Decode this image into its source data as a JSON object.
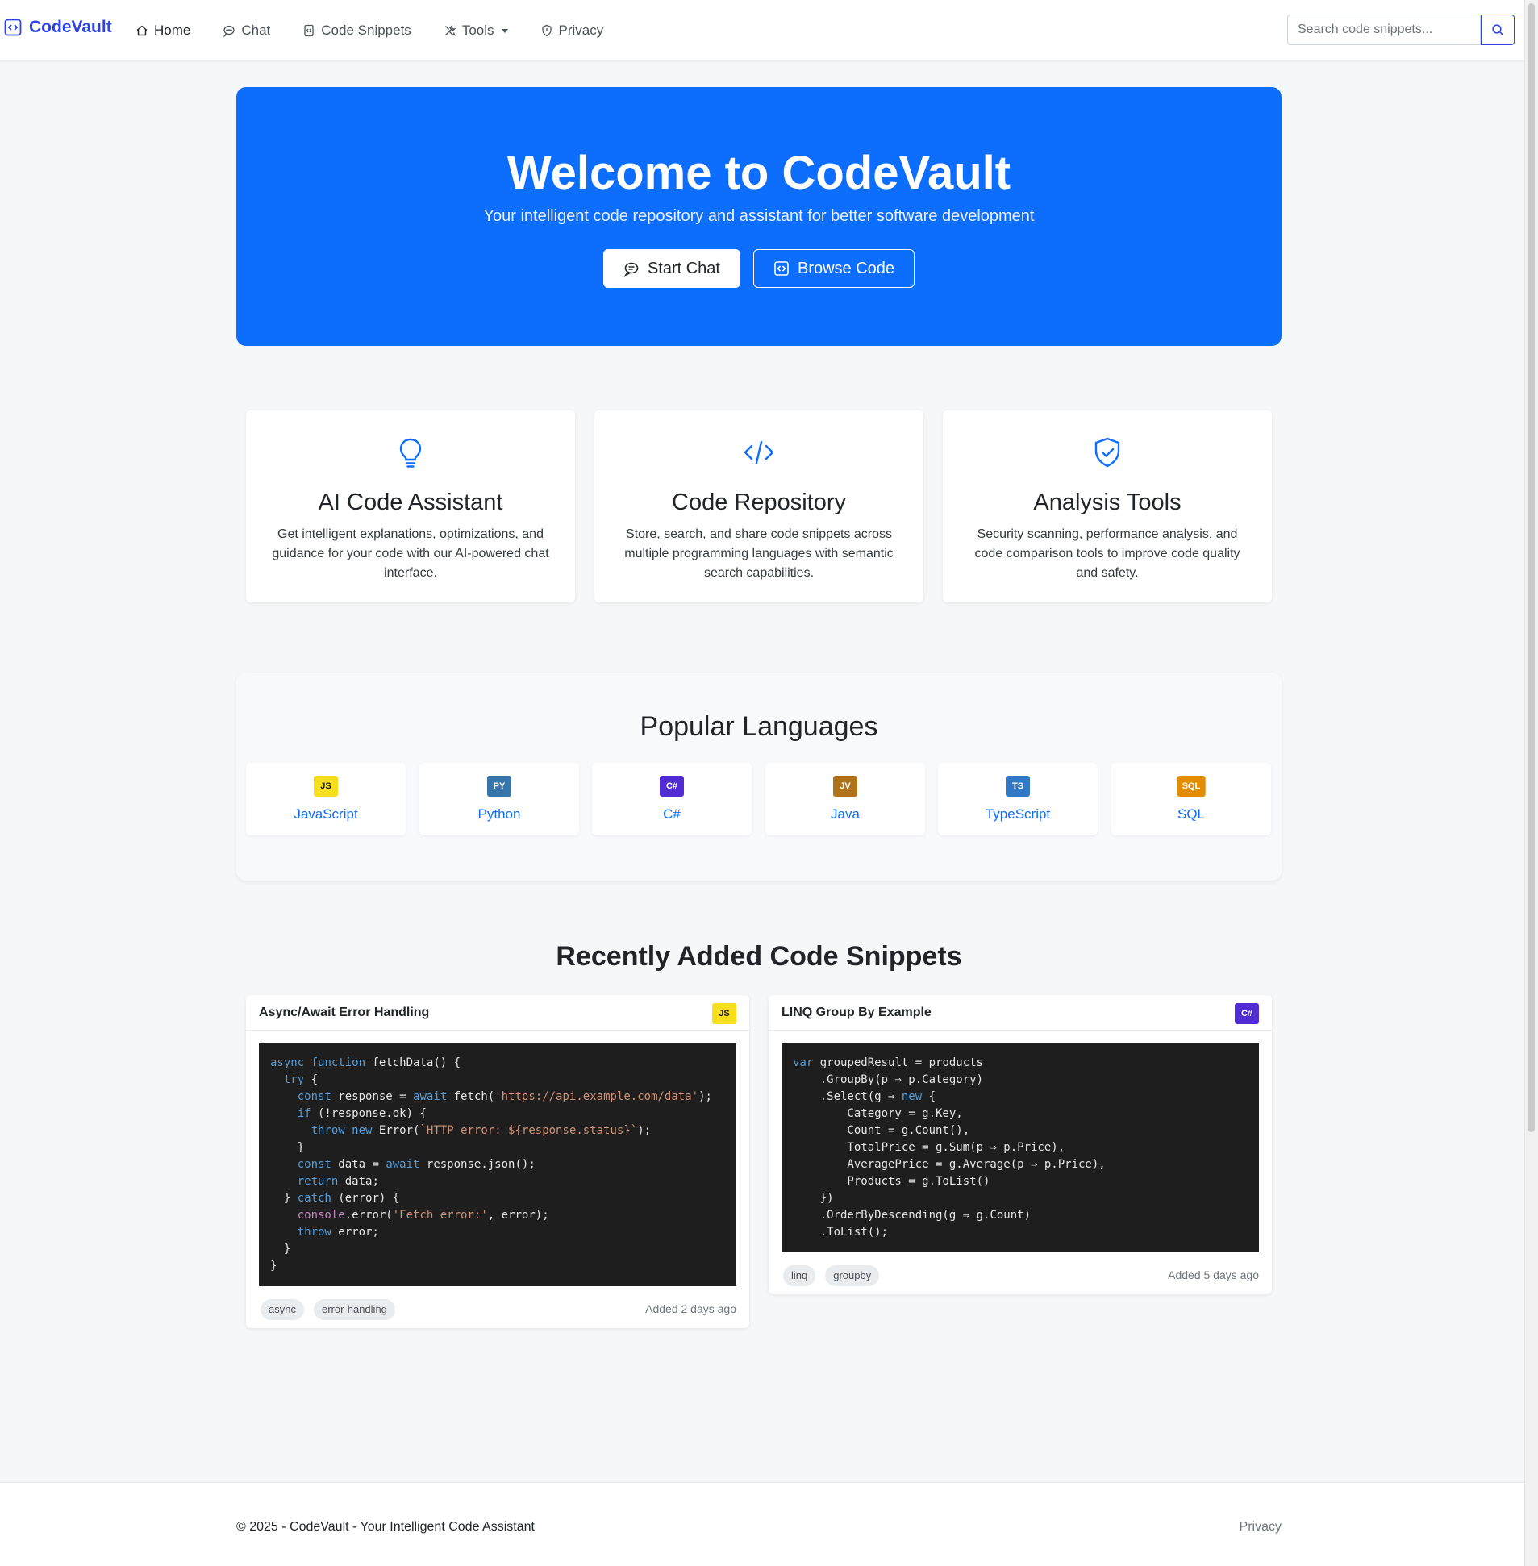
{
  "nav": {
    "brand": "CodeVault",
    "items": [
      {
        "label": "Home",
        "icon": "house-icon",
        "active": true
      },
      {
        "label": "Chat",
        "icon": "chat-icon"
      },
      {
        "label": "Code Snippets",
        "icon": "file-code-icon"
      },
      {
        "label": "Tools",
        "icon": "tools-icon",
        "dropdown": true
      },
      {
        "label": "Privacy",
        "icon": "shield-icon"
      }
    ],
    "search_placeholder": "Search code snippets..."
  },
  "hero": {
    "title": "Welcome to CodeVault",
    "subtitle": "Your intelligent code repository and assistant for better software development",
    "start_chat": "Start Chat",
    "browse_code": "Browse Code",
    "color": "#0d6efd"
  },
  "features": [
    {
      "icon": "lightbulb-icon",
      "title": "AI Code Assistant",
      "text": "Get intelligent explanations, optimizations, and guidance for your code with our AI-powered chat interface."
    },
    {
      "icon": "code-slash-icon",
      "title": "Code Repository",
      "text": "Store, search, and share code snippets across multiple programming languages with semantic search capabilities."
    },
    {
      "icon": "shield-check-icon",
      "title": "Analysis Tools",
      "text": "Security scanning, performance analysis, and code comparison tools to improve code quality and safety."
    }
  ],
  "languages": {
    "title": "Popular Languages",
    "items": [
      {
        "badge": "JS",
        "name": "JavaScript",
        "color": "#f7df1e",
        "text_color": "#212529"
      },
      {
        "badge": "PY",
        "name": "Python",
        "color": "#3776ab",
        "text_color": "#ffffff"
      },
      {
        "badge": "C#",
        "name": "C#",
        "color": "#512bd4",
        "text_color": "#ffffff"
      },
      {
        "badge": "JV",
        "name": "Java",
        "color": "#b07219",
        "text_color": "#ffffff"
      },
      {
        "badge": "TS",
        "name": "TypeScript",
        "color": "#3178c6",
        "text_color": "#ffffff"
      },
      {
        "badge": "SQL",
        "name": "SQL",
        "color": "#e38c00",
        "text_color": "#ffffff"
      }
    ]
  },
  "snippets": {
    "title": "Recently Added Code Snippets",
    "items": [
      {
        "title": "Async/Await Error Handling",
        "badge": "JS",
        "badge_color": "#f7df1e",
        "badge_text_color": "#212529",
        "code": [
          "async function fetchData() {",
          "  try {",
          "    const response = await fetch('https://api.example.com/data');",
          "    if (!response.ok) {",
          "      throw new Error(`HTTP error: ${response.status}`);",
          "    }",
          "    const data = await response.json();",
          "    return data;",
          "  } catch (error) {",
          "    console.error('Fetch error:', error);",
          "    throw error;",
          "  }",
          "}"
        ],
        "tags": [
          "async",
          "error-handling"
        ],
        "added": "Added 2 days ago"
      },
      {
        "title": "LINQ Group By Example",
        "badge": "C#",
        "badge_color": "#512bd4",
        "badge_text_color": "#ffffff",
        "code": [
          "var groupedResult = products",
          "    .GroupBy(p ⇒ p.Category)",
          "    .Select(g ⇒ new {",
          "        Category = g.Key,",
          "        Count = g.Count(),",
          "        TotalPrice = g.Sum(p ⇒ p.Price),",
          "        AveragePrice = g.Average(p ⇒ p.Price),",
          "        Products = g.ToList()",
          "    })",
          "    .OrderByDescending(g ⇒ g.Count)",
          "    .ToList();"
        ],
        "tags": [
          "linq",
          "groupby"
        ],
        "added": "Added 5 days ago"
      }
    ]
  },
  "footer": {
    "copyright": "© 2025 - CodeVault - Your Intelligent Code Assistant",
    "privacy": "Privacy"
  }
}
